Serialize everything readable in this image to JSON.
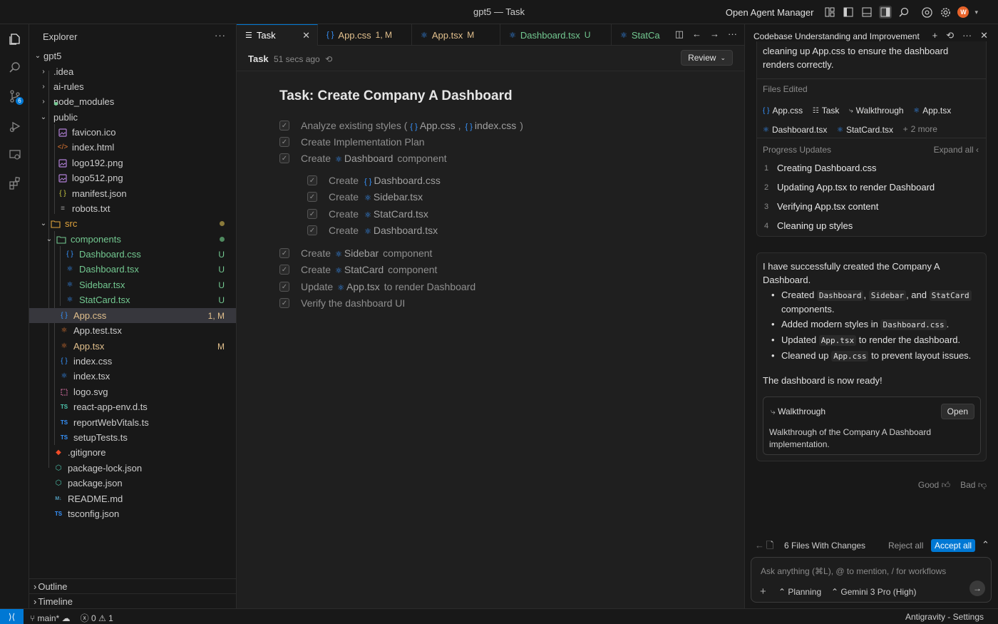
{
  "window": {
    "title": "gpt5 — Task"
  },
  "titlebar": {
    "agent_manager_label": "Open Agent Manager",
    "avatar_letter": "W"
  },
  "activity": {
    "scm_badge": "6"
  },
  "explorer": {
    "header": "Explorer",
    "root": "gpt5",
    "items": [
      {
        "label": ".idea",
        "kind": "folder"
      },
      {
        "label": "ai-rules",
        "kind": "folder"
      },
      {
        "label": "node_modules",
        "kind": "folder"
      },
      {
        "label": "public",
        "kind": "folder"
      },
      {
        "label": "favicon.ico",
        "kind": "image"
      },
      {
        "label": "index.html",
        "kind": "html"
      },
      {
        "label": "logo192.png",
        "kind": "image"
      },
      {
        "label": "logo512.png",
        "kind": "image"
      },
      {
        "label": "manifest.json",
        "kind": "json"
      },
      {
        "label": "robots.txt",
        "kind": "text"
      },
      {
        "label": "src",
        "kind": "folder"
      },
      {
        "label": "components",
        "kind": "folder"
      },
      {
        "label": "Dashboard.css",
        "kind": "css",
        "status": "U"
      },
      {
        "label": "Dashboard.tsx",
        "kind": "react",
        "status": "U"
      },
      {
        "label": "Sidebar.tsx",
        "kind": "react",
        "status": "U"
      },
      {
        "label": "StatCard.tsx",
        "kind": "react",
        "status": "U"
      },
      {
        "label": "App.css",
        "kind": "css",
        "status": "1, M"
      },
      {
        "label": "App.test.tsx",
        "kind": "react"
      },
      {
        "label": "App.tsx",
        "kind": "react",
        "status": "M"
      },
      {
        "label": "index.css",
        "kind": "css"
      },
      {
        "label": "index.tsx",
        "kind": "react"
      },
      {
        "label": "logo.svg",
        "kind": "svg"
      },
      {
        "label": "react-app-env.d.ts",
        "kind": "ts"
      },
      {
        "label": "reportWebVitals.ts",
        "kind": "ts"
      },
      {
        "label": "setupTests.ts",
        "kind": "ts"
      },
      {
        "label": ".gitignore",
        "kind": "git"
      },
      {
        "label": "package-lock.json",
        "kind": "node"
      },
      {
        "label": "package.json",
        "kind": "node"
      },
      {
        "label": "README.md",
        "kind": "md"
      },
      {
        "label": "tsconfig.json",
        "kind": "tsconfig"
      }
    ],
    "outline_label": "Outline",
    "timeline_label": "Timeline"
  },
  "tabs": [
    {
      "label": "Task",
      "icon": "checklist-icon"
    },
    {
      "label": "App.css",
      "status": "1, M"
    },
    {
      "label": "App.tsx",
      "status": "M"
    },
    {
      "label": "Dashboard.tsx",
      "status": "U"
    },
    {
      "label": "StatCa"
    }
  ],
  "task": {
    "name": "Task",
    "ago": "51 secs ago",
    "review_label": "Review",
    "title": "Task: Create Company A Dashboard",
    "items": {
      "i1_pre": "Analyze existing styles (",
      "i1_ref1": "App.css",
      "i1_sep": ",",
      "i1_ref2": "index.css",
      "i1_post": ")",
      "i2": "Create Implementation Plan",
      "i3_pre": "Create",
      "i3_ref": "Dashboard",
      "i3_post": "component",
      "s1_pre": "Create",
      "s1_ref": "Dashboard.css",
      "s2_pre": "Create",
      "s2_ref": "Sidebar.tsx",
      "s3_pre": "Create",
      "s3_ref": "StatCard.tsx",
      "s4_pre": "Create",
      "s4_ref": "Dashboard.tsx",
      "i4_pre": "Create",
      "i4_ref": "Sidebar",
      "i4_post": "component",
      "i5_pre": "Create",
      "i5_ref": "StatCard",
      "i5_post": "component",
      "i6_pre": "Update",
      "i6_ref": "App.tsx",
      "i6_post": "to render Dashboard",
      "i7": "Verify the dashboard UI"
    }
  },
  "agent": {
    "header": "Codebase Understanding and Improvement",
    "top_text": "cleaning up App.css to ensure the dashboard renders correctly.",
    "files_edited_label": "Files Edited",
    "files": [
      "App.css",
      "Task",
      "Walkthrough",
      "App.tsx",
      "Dashboard.tsx",
      "StatCard.tsx"
    ],
    "more_files": "2 more",
    "progress_label": "Progress Updates",
    "expand_label": "Expand all",
    "progress": [
      {
        "n": "1",
        "text": "Creating Dashboard.css"
      },
      {
        "n": "2",
        "text": "Updating App.tsx to render Dashboard"
      },
      {
        "n": "3",
        "text": "Verifying App.tsx content"
      },
      {
        "n": "4",
        "text": "Cleaning up styles"
      }
    ],
    "msg_intro": "I have successfully created the Company A Dashboard.",
    "b1_pre": "Created",
    "b1_c1": "Dashboard",
    "b1_c2": "Sidebar",
    "b1_and": ", and",
    "b1_c3": "StatCard",
    "b1_post": "components.",
    "b2_pre": "Added modern styles in",
    "b2_c": "Dashboard.css",
    "b2_post": ".",
    "b3_pre": "Updated",
    "b3_c": "App.tsx",
    "b3_post": "to render the dashboard.",
    "b4_pre": "Cleaned up",
    "b4_c": "App.css",
    "b4_post": "to prevent layout issues.",
    "msg_done": "The dashboard is now ready!",
    "walkthrough_title": "Walkthrough",
    "walkthrough_open": "Open",
    "walkthrough_desc": "Walkthrough of the Company A Dashboard implementation.",
    "good_label": "Good",
    "bad_label": "Bad",
    "changes_label": "6 Files With Changes",
    "reject_label": "Reject all",
    "accept_label": "Accept all",
    "input_placeholder": "Ask anything (⌘L), @ to mention, / for workflows",
    "mode_label": "Planning",
    "model_label": "Gemini 3 Pro (High)"
  },
  "status": {
    "branch": "main*",
    "errors": "0",
    "warnings": "1",
    "right": "Antigravity - Settings"
  },
  "colors": {
    "accent": "#0078d4",
    "untracked": "#73c991",
    "modified": "#e2c08d"
  }
}
